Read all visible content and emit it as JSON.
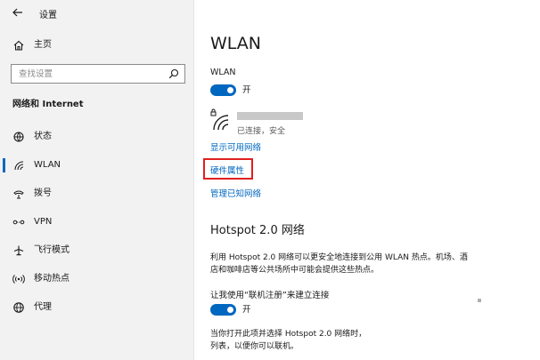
{
  "window": {
    "title": "设置"
  },
  "sidebar": {
    "home_label": "主页",
    "search_placeholder": "查找设置",
    "section_heading": "网络和 Internet",
    "items": [
      {
        "label": "状态",
        "icon": "status-icon"
      },
      {
        "label": "WLAN",
        "icon": "wifi-icon",
        "selected": true
      },
      {
        "label": "拨号",
        "icon": "dialup-icon"
      },
      {
        "label": "VPN",
        "icon": "vpn-icon"
      },
      {
        "label": "飞行模式",
        "icon": "airplane-icon"
      },
      {
        "label": "移动热点",
        "icon": "hotspot-icon"
      },
      {
        "label": "代理",
        "icon": "globe-icon"
      }
    ]
  },
  "main": {
    "title": "WLAN",
    "wlan_label": "WLAN",
    "wlan_toggle_state": "开",
    "network": {
      "status": "已连接，安全"
    },
    "show_available_link": "显示可用网络",
    "hardware_properties_link": "硬件属性",
    "manage_known_link": "管理已知网络",
    "hotspot_section_title": "Hotspot 2.0 网络",
    "hotspot_description_line1": "利用 Hotspot 2.0 网络可以更安全地连接到公用 WLAN 热点。机场、酒",
    "hotspot_description_line2": "店和咖啡店等公共场所中可能会提供这些热点。",
    "online_signup_label": "让我使用“联机注册”来建立连接",
    "online_signup_toggle_state": "开",
    "online_signup_description_line1": "当你打开此项并选择 Hotspot 2.0 网络时，",
    "online_signup_description_line2": "列表，以便你可以联机。"
  },
  "colors": {
    "accent": "#0067c0",
    "highlight_border": "#e02020",
    "sidebar_bg": "#f2f2f2"
  }
}
